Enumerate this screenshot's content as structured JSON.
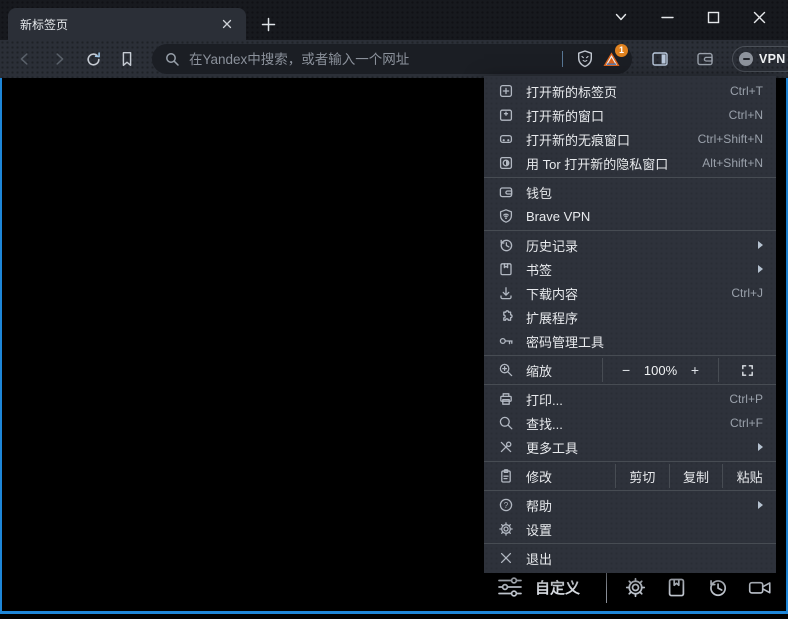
{
  "colors": {
    "accent_blue": "#1e86d8",
    "badge_orange": "#e0821f",
    "titlebar_bg": "#17191e",
    "toolbar_bg": "#2b2f37",
    "urlbar_bg": "#1b1e24",
    "menu_bg": "#2e323b",
    "content_bg": "#000000"
  },
  "window": {
    "tab_title": "新标签页",
    "control_icons": [
      "chevron-down-icon",
      "minimize-icon",
      "maximize-icon",
      "close-icon"
    ],
    "tab_icons": [
      "tab-close-icon",
      "new-tab-plus-icon"
    ]
  },
  "toolbar": {
    "url_placeholder": "在Yandex中搜索，或者输入一个网址",
    "vpn_label": "VPN",
    "rewards_badge": "1",
    "icon_names": [
      "back-icon",
      "forward-icon",
      "reload-icon",
      "bookmark-icon",
      "search-icon",
      "brave-shield-icon",
      "rewards-triangle-icon",
      "sidebar-icon",
      "wallet-icon",
      "vpn-minus-icon",
      "hamburger-menu-icon"
    ]
  },
  "menu": {
    "groups": [
      {
        "items": [
          {
            "name": "menu-item-new-tab",
            "icon": "new-tab-icon",
            "label": "打开新的标签页",
            "shortcut": "Ctrl+T"
          },
          {
            "name": "menu-item-new-window",
            "icon": "new-window-icon",
            "label": "打开新的窗口",
            "shortcut": "Ctrl+N"
          },
          {
            "name": "menu-item-incognito",
            "icon": "incognito-icon",
            "label": "打开新的无痕窗口",
            "shortcut": "Ctrl+Shift+N"
          },
          {
            "name": "menu-item-tor-window",
            "icon": "tor-window-icon",
            "label": "用 Tor 打开新的隐私窗口",
            "shortcut": "Alt+Shift+N"
          }
        ]
      },
      {
        "items": [
          {
            "name": "menu-item-wallet",
            "icon": "wallet-icon",
            "label": "钱包"
          },
          {
            "name": "menu-item-brave-vpn",
            "icon": "vpn-shield-icon",
            "label": "Brave VPN"
          }
        ]
      },
      {
        "items": [
          {
            "name": "menu-item-history",
            "icon": "history-icon",
            "label": "历史记录",
            "submenu": true
          },
          {
            "name": "menu-item-bookmarks",
            "icon": "bookmarks-icon",
            "label": "书签",
            "submenu": true
          },
          {
            "name": "menu-item-downloads",
            "icon": "downloads-icon",
            "label": "下载内容",
            "shortcut": "Ctrl+J"
          },
          {
            "name": "menu-item-extensions",
            "icon": "extensions-icon",
            "label": "扩展程序"
          },
          {
            "name": "menu-item-passwords",
            "icon": "passwords-icon",
            "label": "密码管理工具"
          }
        ]
      },
      {
        "items": [
          {
            "type": "zoom",
            "name": "menu-item-zoom",
            "icon": "zoom-icon",
            "label": "缩放",
            "zoom_out": "−",
            "zoom_value": "100%",
            "zoom_in": "+",
            "fullscreen_icon": "fullscreen-icon"
          }
        ]
      },
      {
        "items": [
          {
            "name": "menu-item-print",
            "icon": "print-icon",
            "label": "打印...",
            "shortcut": "Ctrl+P"
          },
          {
            "name": "menu-item-find",
            "icon": "find-icon",
            "label": "查找...",
            "shortcut": "Ctrl+F"
          },
          {
            "name": "menu-item-more-tools",
            "icon": "more-tools-icon",
            "label": "更多工具",
            "submenu": true
          }
        ]
      },
      {
        "items": [
          {
            "type": "edit",
            "name": "menu-item-edit",
            "icon": "edit-icon",
            "label": "修改",
            "actions": [
              "剪切",
              "复制",
              "粘贴"
            ],
            "action_names": [
              "cut-button",
              "copy-button",
              "paste-button"
            ]
          }
        ]
      },
      {
        "items": [
          {
            "name": "menu-item-help",
            "icon": "help-icon",
            "label": "帮助",
            "submenu": true
          },
          {
            "name": "menu-item-settings",
            "icon": "settings-icon",
            "label": "设置"
          }
        ]
      },
      {
        "items": [
          {
            "name": "menu-item-exit",
            "icon": "exit-icon",
            "label": "退出"
          }
        ]
      }
    ]
  },
  "bottom_bar": {
    "customize_label": "自定义",
    "icon_names": [
      "sliders-icon",
      "gear-icon",
      "saved-bookmarks-icon",
      "history-clock-icon",
      "camera-icon"
    ]
  }
}
